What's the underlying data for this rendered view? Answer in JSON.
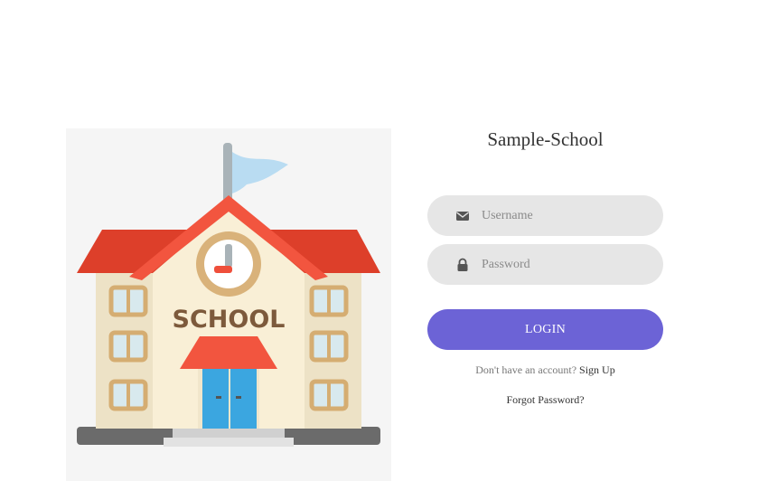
{
  "brand": {
    "title": "Sample-School"
  },
  "illustration": {
    "sign_text": "SCHOOL"
  },
  "form": {
    "username_placeholder": "Username",
    "password_placeholder": "Password",
    "login_label": "LOGIN"
  },
  "links": {
    "no_account_text": "Don't have an account?",
    "signup_label": "Sign Up",
    "forgot_label": "Forgot Password?"
  },
  "icons": {
    "username": "envelope-icon",
    "password": "lock-icon"
  },
  "colors": {
    "accent": "#6c63d6",
    "field_bg": "#e6e6e6",
    "illustration_bg": "#f5f5f5"
  }
}
